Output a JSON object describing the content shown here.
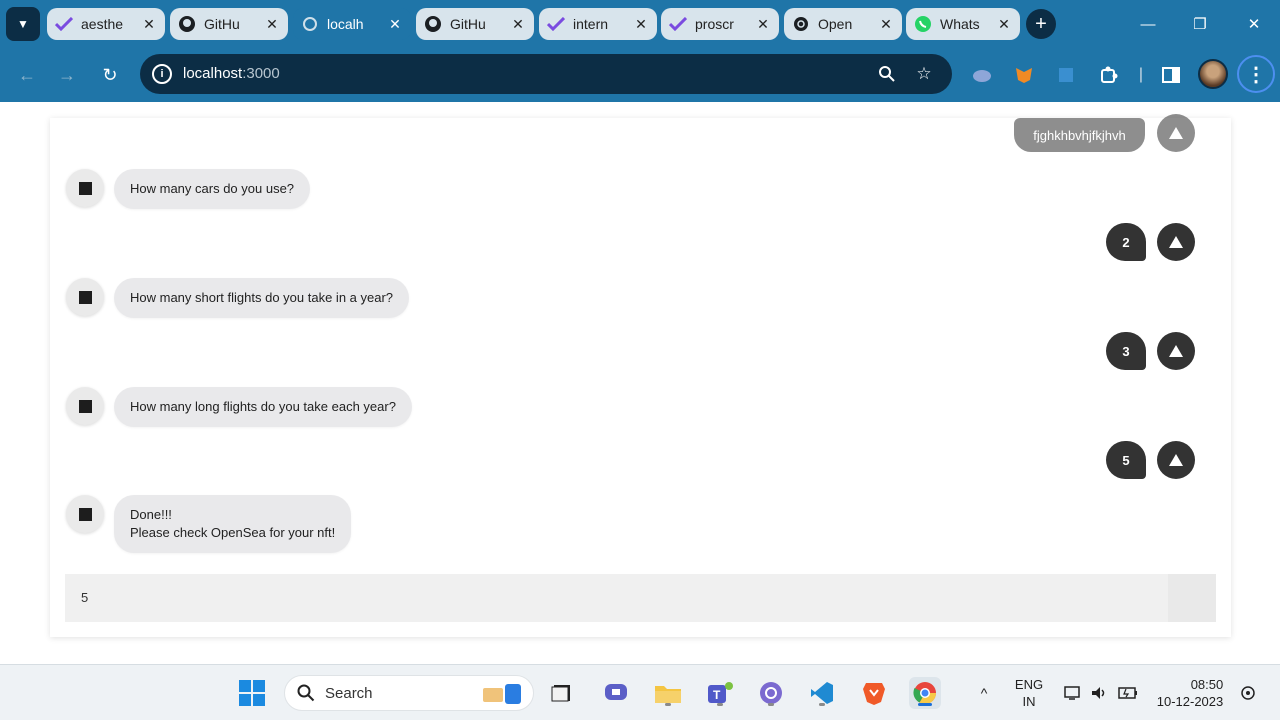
{
  "browser": {
    "tabs": [
      {
        "title": "aesthe",
        "icon": "purple-check-icon"
      },
      {
        "title": "GitHu",
        "icon": "github-icon"
      },
      {
        "title": "localh",
        "icon": "loading-globe-icon",
        "active": true
      },
      {
        "title": "GitHu",
        "icon": "github-icon"
      },
      {
        "title": "intern",
        "icon": "purple-check-icon"
      },
      {
        "title": "proscr",
        "icon": "purple-check-icon"
      },
      {
        "title": "Open",
        "icon": "openai-icon"
      },
      {
        "title": "Whats",
        "icon": "whatsapp-icon"
      }
    ],
    "new_tab": "+",
    "url_host": "localhost",
    "url_port": ":3000"
  },
  "chat": {
    "top_user_reply": "fjghkhbvhjfkjhvh",
    "messages": [
      {
        "question": "How many cars do you use?",
        "answer": "2"
      },
      {
        "question": "How many short flights do you take in a year?",
        "answer": "3"
      },
      {
        "question": "How many long flights do you take each year?",
        "answer": "5"
      }
    ],
    "final_line1": "Done!!!",
    "final_line2": "Please check OpenSea for your nft!",
    "input_value": "5"
  },
  "taskbar": {
    "search_label": "Search",
    "lang_line1": "ENG",
    "lang_line2": "IN",
    "time": "08:50",
    "date": "10-12-2023"
  },
  "colors": {
    "chrome_bar": "#1f75a8",
    "chrome_dark": "#0c2d45",
    "bot_bubble": "#e9e9eb",
    "user_bubble": "#333333"
  }
}
